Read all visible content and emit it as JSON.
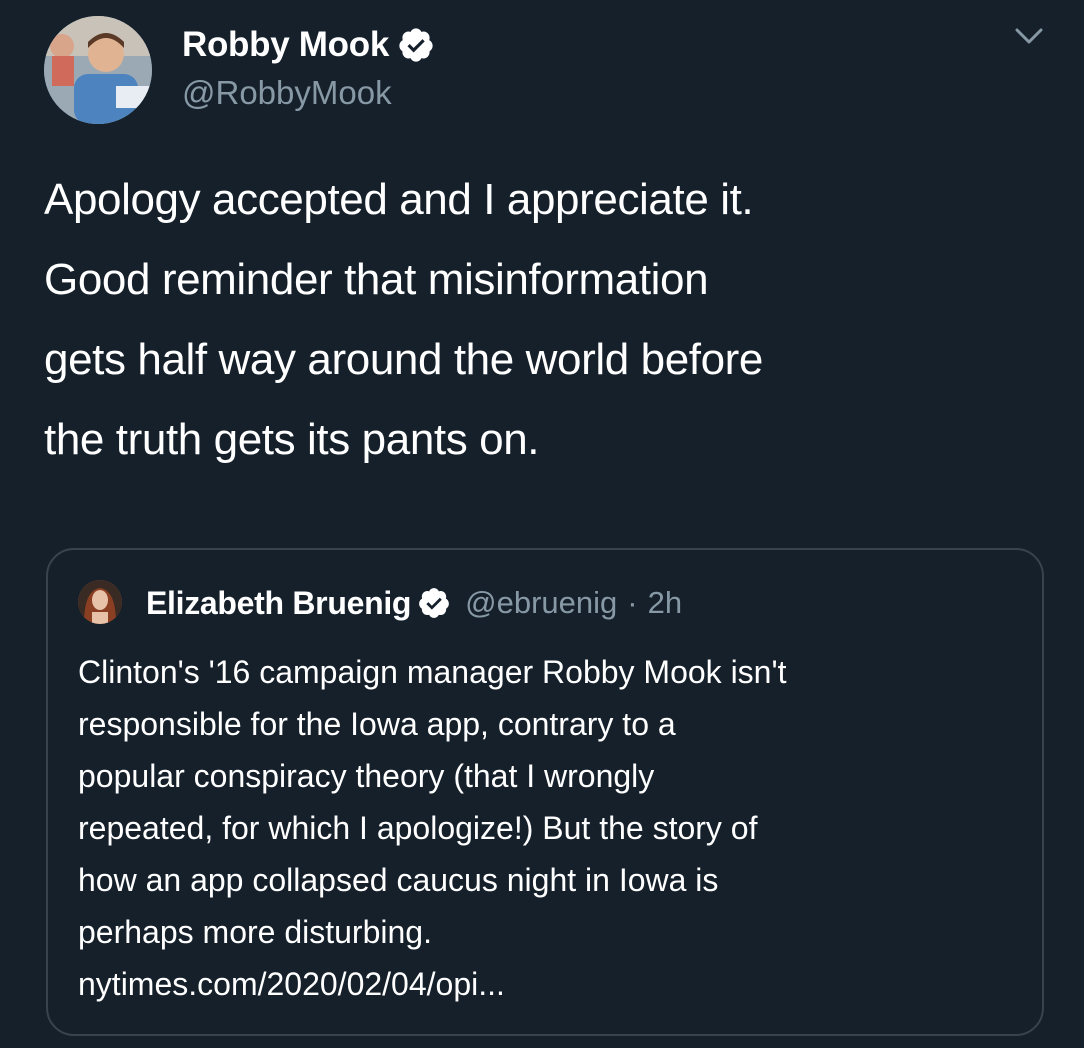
{
  "tweet": {
    "author_name": "Robby Mook",
    "author_handle": "@RobbyMook",
    "text": "Apology accepted and I appreciate it.\nGood reminder that misinformation\ngets half way around the world before\nthe truth gets its pants on."
  },
  "quoted_tweet": {
    "author_name": "Elizabeth Bruenig",
    "author_handle": "@ebruenig",
    "separator": "·",
    "time": "2h",
    "text": "Clinton's '16 campaign manager Robby Mook isn't\nresponsible for the Iowa app, contrary to a\npopular conspiracy theory (that I wrongly\nrepeated, for which I apologize!) But the story of\nhow an app collapsed caucus night in Iowa is\nperhaps more disturbing.\nnytimes.com/2020/02/04/opi..."
  },
  "icons": {
    "verified": "verified-badge-icon",
    "menu": "chevron-down-icon"
  },
  "colors": {
    "background": "#15202b",
    "secondary_text": "#8899a6",
    "border": "#38444d"
  }
}
